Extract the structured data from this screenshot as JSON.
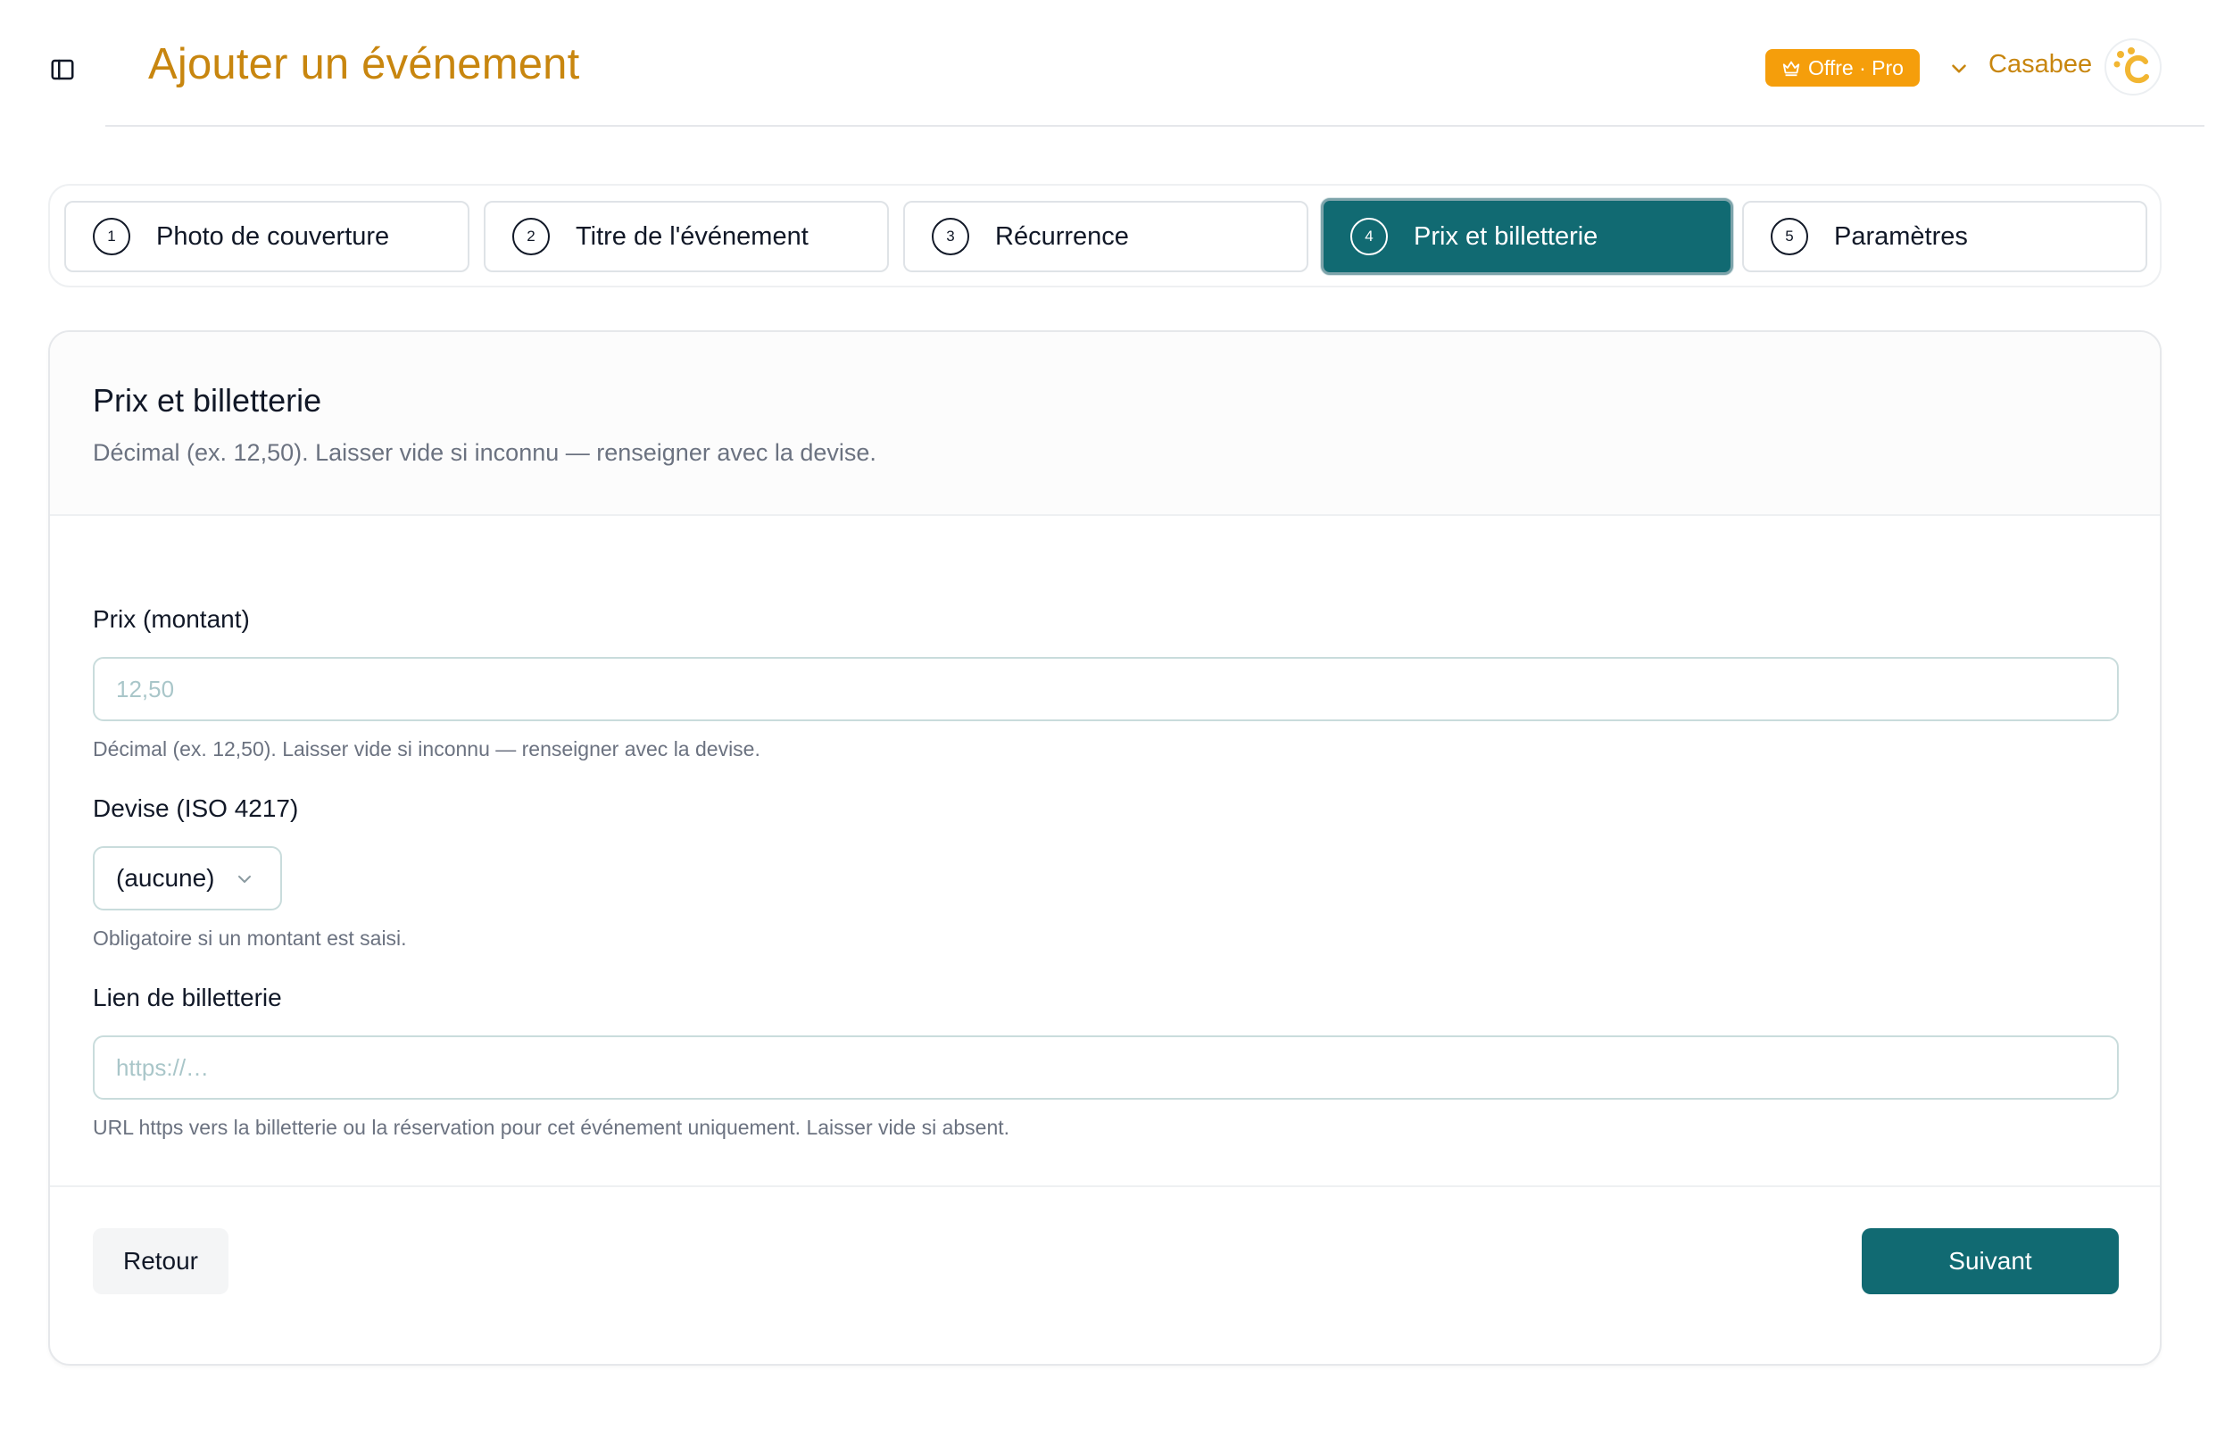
{
  "header": {
    "title": "Ajouter un événement",
    "plan_badge": "Offre · Pro",
    "account_name": "Casabee",
    "avatar_letter": "c"
  },
  "steps": [
    {
      "number": "1",
      "label": "Photo de couverture",
      "active": false
    },
    {
      "number": "2",
      "label": "Titre de l'événement",
      "active": false
    },
    {
      "number": "3",
      "label": "Récurrence",
      "active": false
    },
    {
      "number": "4",
      "label": "Prix et billetterie",
      "active": true
    },
    {
      "number": "5",
      "label": "Paramètres",
      "active": false
    }
  ],
  "card": {
    "title": "Prix et billetterie",
    "description": "Décimal (ex. 12,50). Laisser vide si inconnu — renseigner avec la devise.",
    "price": {
      "label": "Prix (montant)",
      "value": "",
      "placeholder": "12,50",
      "hint": "Décimal (ex. 12,50). Laisser vide si inconnu — renseigner avec la devise."
    },
    "currency": {
      "label": "Devise (ISO 4217)",
      "selected": "(aucune)",
      "hint": "Obligatoire si un montant est saisi."
    },
    "ticket_link": {
      "label": "Lien de billetterie",
      "value": "",
      "placeholder": "https://…",
      "hint": "URL https vers la billetterie ou la réservation pour cet événement uniquement. Laisser vide si absent."
    },
    "back_label": "Retour",
    "next_label": "Suivant"
  },
  "colors": {
    "brand_orange": "#c8860f",
    "badge_orange": "#f59e0b",
    "teal": "#116a72"
  },
  "icons": {
    "sidebar_toggle": "sidebar-panel-icon",
    "badge": "crown-icon",
    "account_menu": "chevron-down-icon",
    "select": "chevron-down-icon"
  }
}
